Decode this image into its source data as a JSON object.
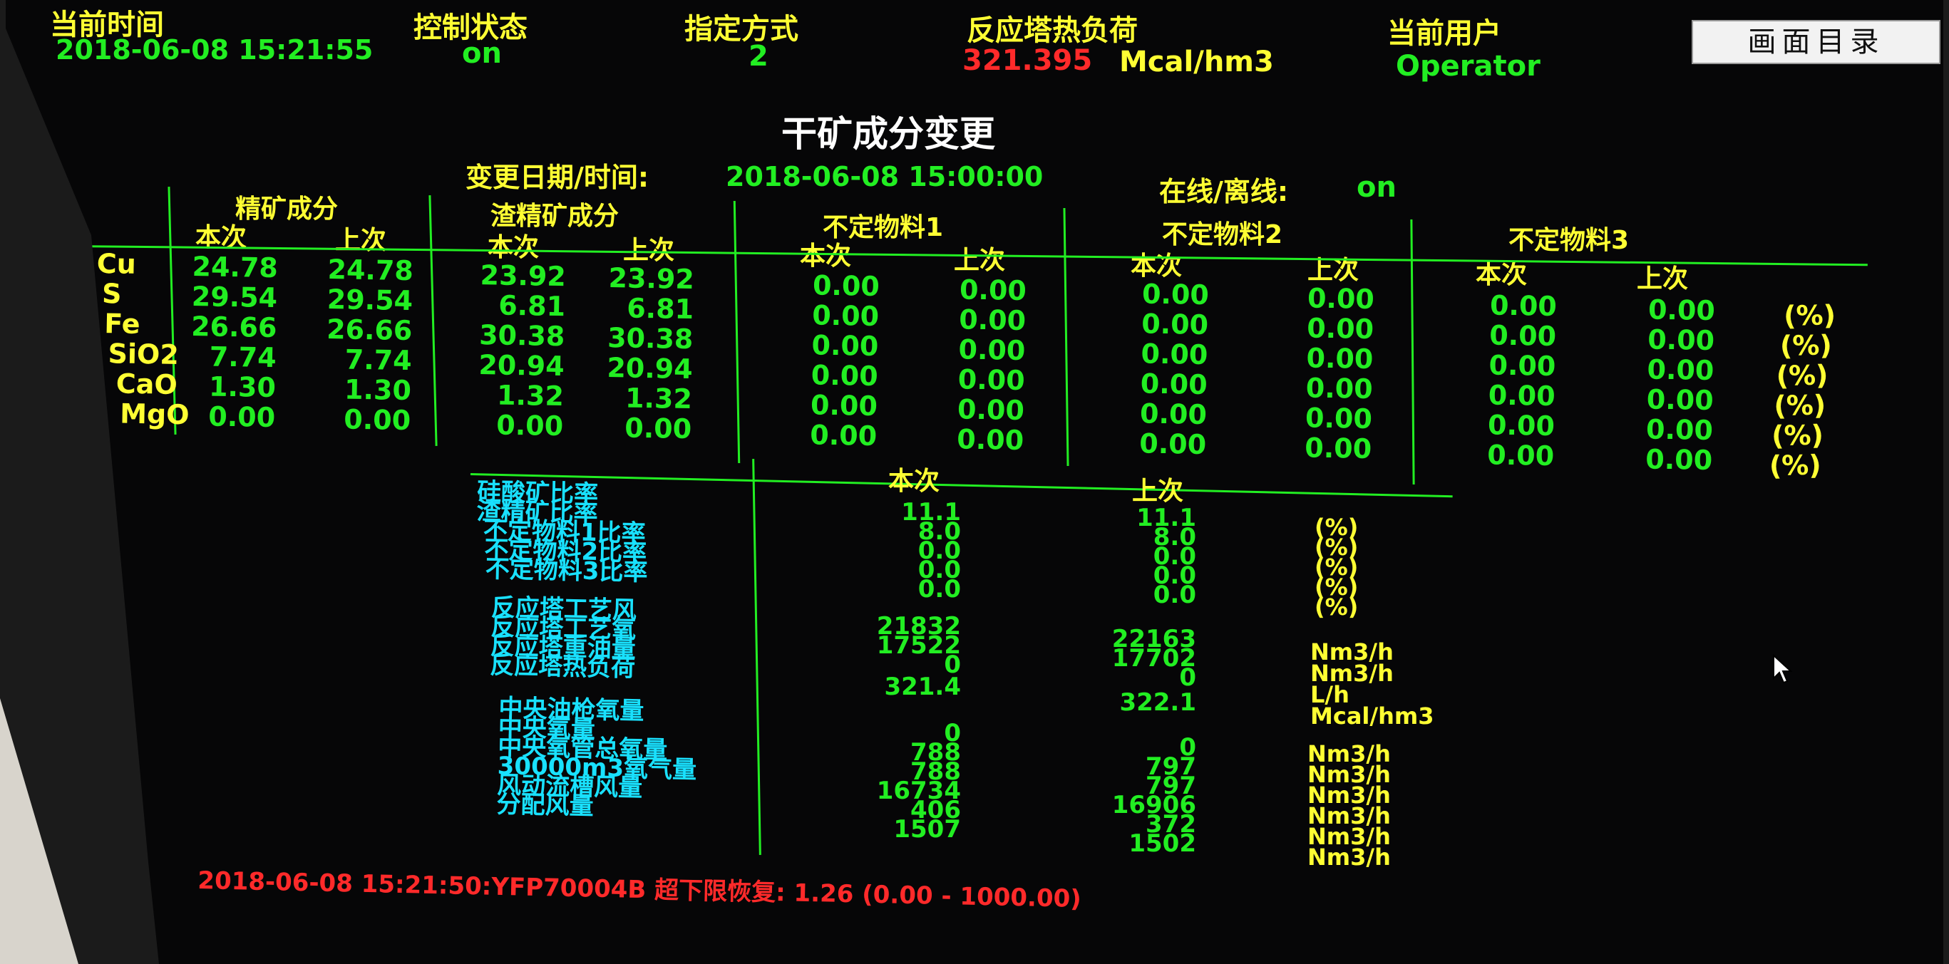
{
  "header": {
    "time_label": "当前时间",
    "time_value": "2018-06-08 15:21:55",
    "control_label": "控制状态",
    "control_value": "on",
    "mode_label": "指定方式",
    "mode_value": "2",
    "heat_label": "反应塔热负荷",
    "heat_value": "321.395",
    "heat_unit": "Mcal/hm3",
    "user_label": "当前用户",
    "user_value": "Operator",
    "menu_button": "画面目录"
  },
  "page_title": "干矿成分变更",
  "change": {
    "date_label": "变更日期/时间:",
    "date_value": "2018-06-08 15:00:00",
    "online_label": "在线/离线:",
    "online_value": "on"
  },
  "composition": {
    "element_labels": [
      "Cu",
      "S",
      "Fe",
      "SiO2",
      "CaO",
      "MgO"
    ],
    "cur_label": "本次",
    "prev_label": "上次",
    "groups": [
      {
        "title": "精矿成分",
        "current": [
          "24.78",
          "29.54",
          "26.66",
          "7.74",
          "1.30",
          "0.00"
        ],
        "previous": [
          "24.78",
          "29.54",
          "26.66",
          "7.74",
          "1.30",
          "0.00"
        ]
      },
      {
        "title": "渣精矿成分",
        "current": [
          "23.92",
          "6.81",
          "30.38",
          "20.94",
          "1.32",
          "0.00"
        ],
        "previous": [
          "23.92",
          "6.81",
          "30.38",
          "20.94",
          "1.32",
          "0.00"
        ]
      },
      {
        "title": "不定物料1",
        "current": [
          "0.00",
          "0.00",
          "0.00",
          "0.00",
          "0.00",
          "0.00"
        ],
        "previous": [
          "0.00",
          "0.00",
          "0.00",
          "0.00",
          "0.00",
          "0.00"
        ]
      },
      {
        "title": "不定物料2",
        "current": [
          "0.00",
          "0.00",
          "0.00",
          "0.00",
          "0.00",
          "0.00"
        ],
        "previous": [
          "0.00",
          "0.00",
          "0.00",
          "0.00",
          "0.00",
          "0.00"
        ]
      },
      {
        "title": "不定物料3",
        "current": [
          "0.00",
          "0.00",
          "0.00",
          "0.00",
          "0.00",
          "0.00"
        ],
        "previous": [
          "0.00",
          "0.00",
          "0.00",
          "0.00",
          "0.00",
          "0.00"
        ]
      }
    ],
    "units": [
      "(%)",
      "(%)",
      "(%)",
      "(%)",
      "(%)",
      "(%)"
    ]
  },
  "ratios": {
    "cur_label": "本次",
    "prev_label": "上次",
    "labels": [
      "硅酸矿比率",
      "渣精矿比率",
      "不定物料1比率",
      "不定物料2比率",
      "不定物料3比率"
    ],
    "current": [
      "11.1",
      "8.0",
      "0.0",
      "0.0",
      "0.0"
    ],
    "previous": [
      "11.1",
      "8.0",
      "0.0",
      "0.0",
      "0.0"
    ],
    "units": [
      "(%)",
      "(%)",
      "(%)",
      "(%)",
      "(%)"
    ]
  },
  "reactor": {
    "labels": [
      "反应塔工艺风",
      "反应塔工艺氧",
      "反应塔重油量",
      "反应塔热负荷"
    ],
    "current": [
      "21832",
      "17522",
      "0",
      "321.4"
    ],
    "previous": [
      "22163",
      "17702",
      "0",
      "322.1"
    ],
    "units": [
      "Nm3/h",
      "Nm3/h",
      "L/h",
      "Mcal/hm3"
    ]
  },
  "oxygen": {
    "labels": [
      "中央油枪氧量",
      "中央氧量",
      "中央氧管总氧量",
      "30000m3氧气量",
      "风动流槽风量",
      "分配风量"
    ],
    "current": [
      "0",
      "788",
      "788",
      "16734",
      "406",
      "1507"
    ],
    "previous": [
      "0",
      "797",
      "797",
      "16906",
      "372",
      "1502"
    ],
    "units": [
      "Nm3/h",
      "Nm3/h",
      "Nm3/h",
      "Nm3/h",
      "Nm3/h",
      "Nm3/h"
    ]
  },
  "alarm": "2018-06-08 15:21:50:YFP70004B 超下限恢复:  1.26  (0.00 - 1000.00)",
  "colors": {
    "label": "#ffff33",
    "value": "#22ee22",
    "alert": "#ff2a2a",
    "sublabel": "#19e1ff"
  }
}
